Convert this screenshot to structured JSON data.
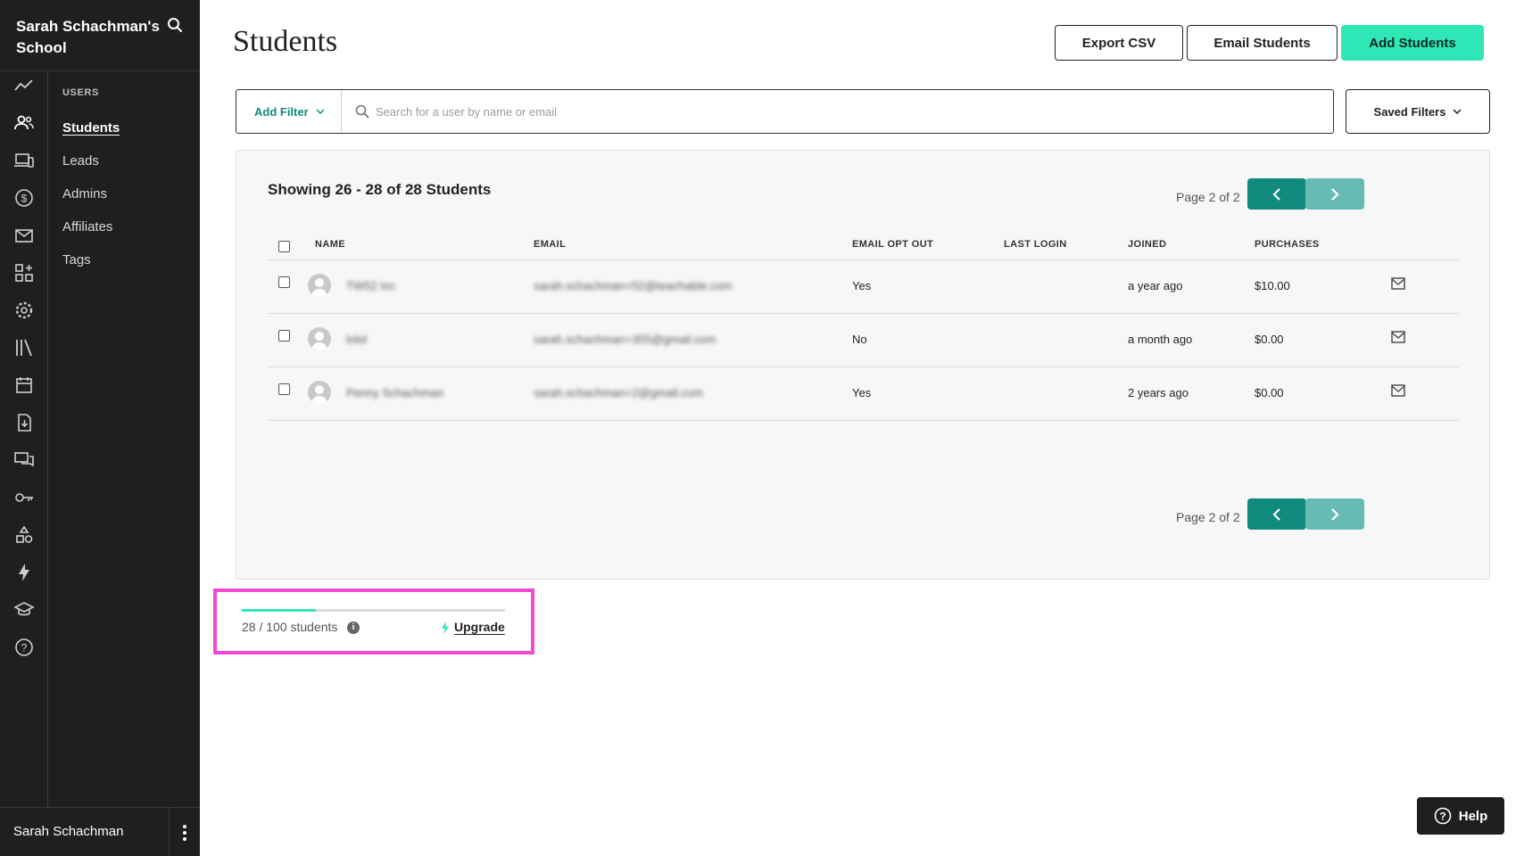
{
  "school": {
    "name": "Sarah Schachman's School"
  },
  "sidebar": {
    "rail_icons": [
      "analytics-icon",
      "users-icon",
      "devices-icon",
      "dollar-icon",
      "mail-icon",
      "apps-icon",
      "gear-icon",
      "library-icon",
      "calendar-icon",
      "download-doc-icon",
      "comments-icon",
      "key-icon",
      "shapes-icon",
      "bolt-icon",
      "graduation-cap-icon",
      "help-circle-icon"
    ],
    "section_heading": "USERS",
    "items": [
      {
        "label": "Students",
        "active": true
      },
      {
        "label": "Leads",
        "active": false
      },
      {
        "label": "Admins",
        "active": false
      },
      {
        "label": "Affiliates",
        "active": false
      },
      {
        "label": "Tags",
        "active": false
      }
    ],
    "user_name": "Sarah Schachman"
  },
  "page": {
    "title": "Students"
  },
  "toolbar": {
    "export_label": "Export CSV",
    "email_label": "Email Students",
    "add_label": "Add Students"
  },
  "filters": {
    "add_filter_label": "Add Filter",
    "search_placeholder": "Search for a user by name or email",
    "saved_filters_label": "Saved Filters"
  },
  "table": {
    "showing_text": "Showing 26 - 28 of 28 Students",
    "page_text": "Page 2 of 2",
    "columns": [
      "NAME",
      "EMAIL",
      "EMAIL OPT OUT",
      "LAST LOGIN",
      "JOINED",
      "PURCHASES"
    ],
    "rows": [
      {
        "name": "TW52 Inc",
        "email": "sarah.schachman+52@teachable.com",
        "opt_out": "Yes",
        "last_login": "",
        "joined": "a year ago",
        "purchases": "$10.00"
      },
      {
        "name": "lolol",
        "email": "sarah.schachman+355@gmail.com",
        "opt_out": "No",
        "last_login": "",
        "joined": "a month ago",
        "purchases": "$0.00"
      },
      {
        "name": "Penny Schachman",
        "email": "sarah.schachman+2@gmail.com",
        "opt_out": "Yes",
        "last_login": "",
        "joined": "2 years ago",
        "purchases": "$0.00"
      }
    ]
  },
  "plan": {
    "count_text": "28 / 100 students",
    "usage_fraction": 0.28,
    "upgrade_label": "Upgrade"
  },
  "help": {
    "label": "Help"
  },
  "colors": {
    "accent": "#2ee6b6",
    "teal": "#0f8a7d",
    "teal_light": "#66bcb3",
    "highlight": "#f249d3",
    "sidebar": "#1f1f1f"
  }
}
